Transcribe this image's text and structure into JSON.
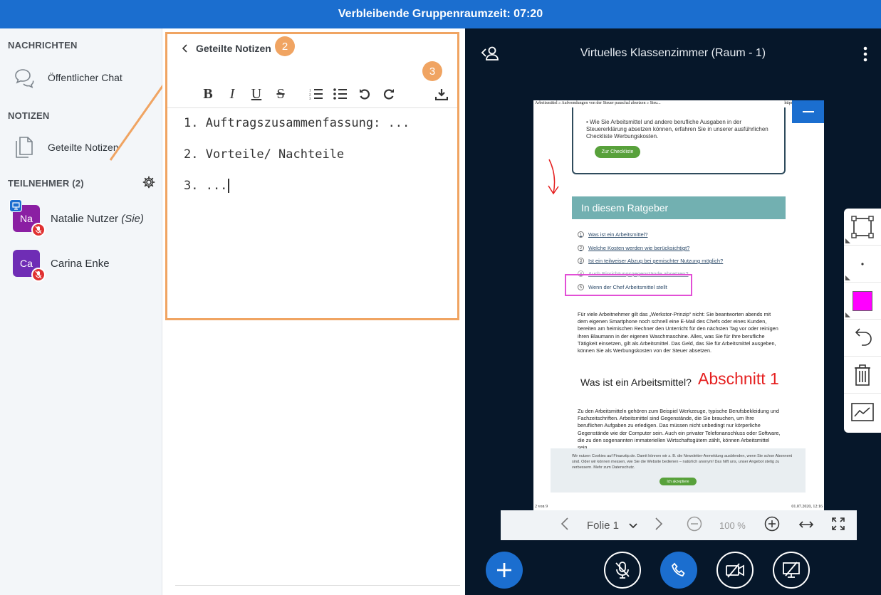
{
  "topbar": {
    "text": "Verbleibende Gruppenraumzeit: 07:20"
  },
  "sidebar": {
    "messages_title": "NACHRICHTEN",
    "public_chat": "Öffentlicher Chat",
    "notes_title": "NOTIZEN",
    "shared_notes": "Geteilte Notizen",
    "participants_title": "TEILNEHMER (2)",
    "users": [
      {
        "initials": "Na",
        "name": "Natalie Nutzer",
        "suffix": "(Sie)",
        "color": "#8b1fa3"
      },
      {
        "initials": "Ca",
        "name": "Carina Enke",
        "suffix": "",
        "color": "#6f2db5"
      }
    ]
  },
  "notes": {
    "back_label": "Geteilte Notizen",
    "badge_2": "2",
    "badge_3": "3",
    "lines": [
      "1. Auftragszusammenfassung: ...",
      "2. Vorteile/ Nachteile",
      "3. ..."
    ],
    "accent": "#f0a462"
  },
  "main": {
    "title": "Virtuelles Klassenzimmer (Raum - 1)",
    "slide": {
      "header_left": "Arbeitsmittel » Aufwendungen von der Steuer pauschal absetzen » Steu...",
      "header_right": "https://www.finanztip.",
      "bullet": "Wie Sie Arbeitsmittel und andere berufliche Ausgaben in der Steuererklärung absetzen können, erfahren Sie in unserer ausführlichen Checkliste Werbungskosten.",
      "checklist_btn": "Zur Checkliste",
      "ratgeber": "In diesem Ratgeber",
      "toc": [
        "Was ist ein Arbeitsmittel?",
        "Welche Kosten werden wie berücksichtigt?",
        "Ist ein teilweiser Abzug bei gemischter Nutzung möglich?",
        "Auch Einrichtungsgegenstände absetzen?",
        "Wenn der Chef Arbeitsmittel stellt"
      ],
      "toc_nums": [
        "1",
        "2",
        "3",
        "4",
        "5"
      ],
      "para1": "Für viele Arbeitnehmer gilt das „Werkstor-Prinzip“ nicht: Sie beantworten abends mit dem eigenen Smartphone noch schnell eine E-Mail des Chefs oder eines Kunden, bereiten am heimischen Rechner den Unterricht für den nächsten Tag vor oder reinigen ihren Blaumann in der eigenen Waschmaschine. Alles, was Sie für Ihre berufliche Tätigkeit einsetzen, gilt als Arbeitsmittel. Das Geld, das Sie für Arbeitsmittel ausgeben, können Sie als Werbungskosten von der Steuer absetzen.",
      "h2": "Was ist ein Arbeitsmittel?",
      "annotation": "Abschnitt 1",
      "para2": "Zu den Arbeitsmitteln gehören zum Beispiel Werkzeuge, typische Berufsbekleidung und Fachzeitschriften. Arbeitsmittel sind Gegenstände, die Sie brauchen, um Ihre beruflichen Aufgaben zu erledigen. Das müssen nicht unbedingt nur körperliche Gegenstände wie der Computer sein. Auch ein privater Telefonanschluss oder Software, die zu den sogenannten immateriellen Wirtschaftsgütern zählt, können Arbeitsmittel sein.",
      "cookie": "Wir nutzen Cookies auf Finanztip.de. Damit können wir z. B. die Newsletter-Anmeldung ausblenden, wenn Sie schon Abonnent sind. Oder wir können messen, wie Sie die Website bedienen – natürlich anonym! Das hilft uns, unser Angebot stetig zu verbessern. Mehr zum Datenschutz.",
      "cookie_btn": "Ich akzeptiere",
      "footer_left": "2 von 9",
      "footer_right": "01.07.2020, 12:16"
    },
    "slide_nav": {
      "slide_label": "Folie 1",
      "zoom": "100 %"
    },
    "pen_color": "#ff00ff"
  }
}
